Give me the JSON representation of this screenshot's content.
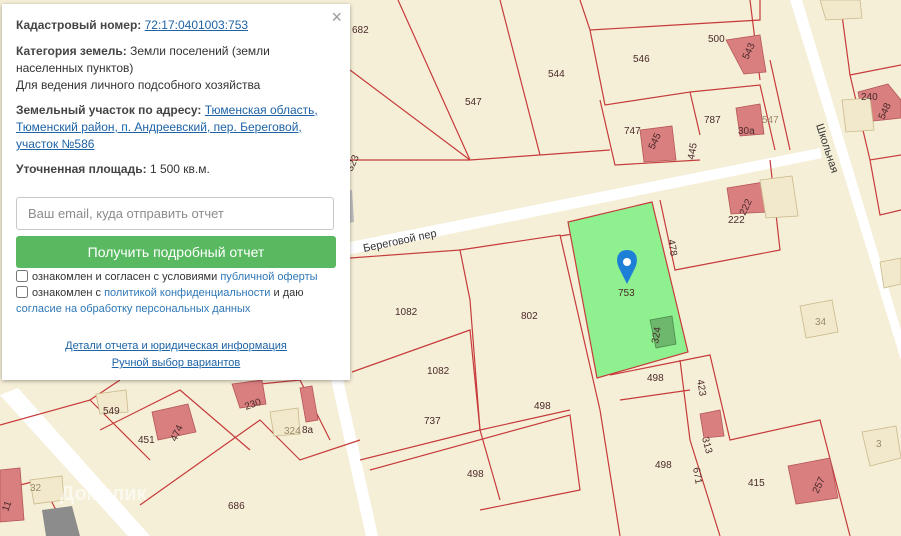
{
  "panel": {
    "close_icon": "×",
    "cadastral_label": "Кадастровый номер:",
    "cadastral_number": "72:17:0401003:753",
    "category_label": "Категория земель:",
    "category_value": "Земли поселений (земли населенных пунктов)",
    "usage": "Для ведения личного подсобного хозяйства",
    "address_label": "Земельный участок по адресу:",
    "address_value": "Тюменская область, Тюменский район, п. Андреевский, пер. Береговой, участок №586",
    "area_label": "Уточненная площадь:",
    "area_value": "1 500 кв.м.",
    "email_placeholder": "Ваш email, куда отправить отчет",
    "submit_label": "Получить подробный отчет",
    "consent1_text": "ознакомлен и согласен с условиями",
    "consent1_link": "публичной оферты",
    "consent2_text_a": "ознакомлен с",
    "consent2_link_a": "политикой конфиденциальности",
    "consent2_text_b": "и даю",
    "consent2_link_b": "согласие на обработку персональных данных",
    "details_link": "Детали отчета и юридическая информация",
    "manual_link": "Ручной выбор вариантов"
  },
  "map": {
    "selected_parcel": "753",
    "street_beregovoy": "Береговой пер",
    "street_shkolnaya": "Школьная",
    "watermark": "Домклик",
    "parcel_numbers": [
      "682",
      "546",
      "500",
      "543",
      "544",
      "547",
      "747",
      "545",
      "787",
      "30а",
      "547",
      "445",
      "240",
      "548",
      "222",
      "222",
      "478",
      "323",
      "1082",
      "802",
      "324",
      "1082",
      "498",
      "498",
      "423",
      "549",
      "230",
      "451",
      "474",
      "8а",
      "324",
      "737",
      "313",
      "498",
      "498",
      "671",
      "415",
      "257",
      "686",
      "11",
      "32",
      "34",
      "3"
    ]
  },
  "colors": {
    "map_background": "#f6efd8",
    "parcel_border": "#c63b3b",
    "selected_parcel_fill": "#8ef08e",
    "building_fill": "#d97f80",
    "button_green": "#59b960",
    "link_blue": "#1d63a6"
  }
}
